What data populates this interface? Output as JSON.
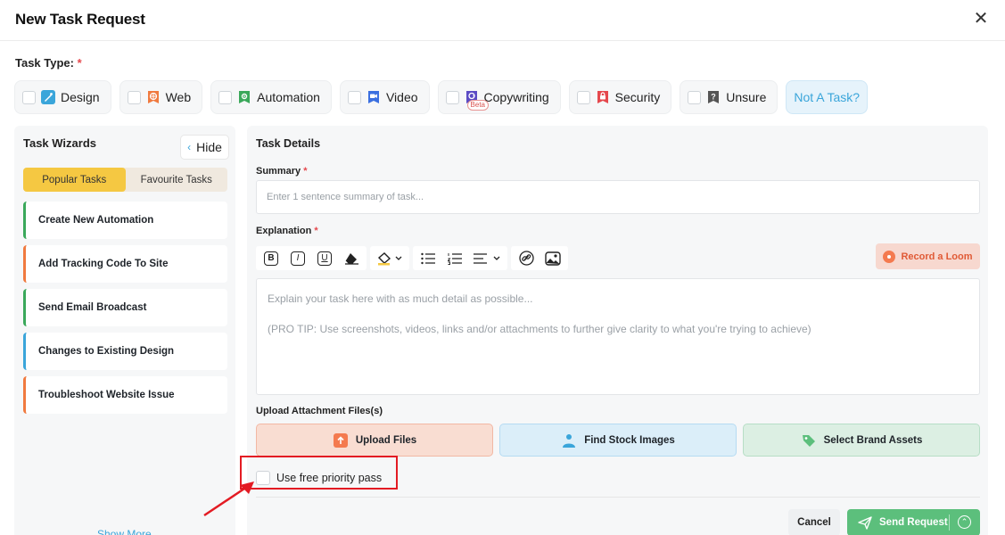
{
  "dialog": {
    "title": "New Task Request"
  },
  "task_type": {
    "label": "Task Type:",
    "required_mark": "*",
    "types": [
      {
        "label": "Design",
        "icon": "design-icon",
        "color": "#3aa5da"
      },
      {
        "label": "Web",
        "icon": "web-icon",
        "color": "#f07a3f"
      },
      {
        "label": "Automation",
        "icon": "automation-icon",
        "color": "#3aa85a"
      },
      {
        "label": "Video",
        "icon": "video-icon",
        "color": "#3b6fe0"
      },
      {
        "label": "Copywriting",
        "icon": "copywriting-icon",
        "color": "#5b4bc4",
        "badge": "Beta"
      },
      {
        "label": "Security",
        "icon": "security-icon",
        "color": "#e5484d"
      },
      {
        "label": "Unsure",
        "icon": "unsure-icon",
        "color": "#666666"
      }
    ],
    "not_a_task": "Not A Task?"
  },
  "sidebar": {
    "title": "Task Wizards",
    "hide_label": "Hide",
    "tabs": [
      {
        "label": "Popular Tasks",
        "active": true
      },
      {
        "label": "Favourite Tasks",
        "active": false
      }
    ],
    "wizards": [
      {
        "label": "Create New Automation",
        "color": "#3aa85a"
      },
      {
        "label": "Add Tracking Code To Site",
        "color": "#f07a3f"
      },
      {
        "label": "Send Email Broadcast",
        "color": "#3aa85a"
      },
      {
        "label": "Changes to Existing Design",
        "color": "#3aa5da"
      },
      {
        "label": "Troubleshoot Website Issue",
        "color": "#f07a3f"
      }
    ],
    "show_more": "Show More"
  },
  "details": {
    "title": "Task Details",
    "summary_label": "Summary",
    "summary_placeholder": "Enter 1 sentence summary of task...",
    "summary_value": "",
    "explanation_label": "Explanation",
    "toolbar": [
      "bold",
      "italic",
      "underline",
      "eraser",
      "highlight",
      "bulleted-list",
      "numbered-list",
      "align",
      "link",
      "image"
    ],
    "record_loom": "Record a Loom",
    "explanation_placeholder_1": "Explain your task here with as much detail as possible...",
    "explanation_placeholder_2": "(PRO TIP: Use screenshots, videos, links and/or attachments to further give clarity to what you're trying to achieve)",
    "attachments_label": "Upload Attachment Files(s)",
    "upload_files": "Upload Files",
    "find_stock": "Find Stock Images",
    "brand_assets": "Select Brand Assets",
    "priority_pass": "Use free priority pass"
  },
  "footer": {
    "cancel": "Cancel",
    "send": "Send Request"
  },
  "colors": {
    "accent_yellow": "#f5c842",
    "accent_green": "#5cbf7c",
    "accent_blue": "#3aa5da",
    "highlight_red": "#e31b23"
  }
}
